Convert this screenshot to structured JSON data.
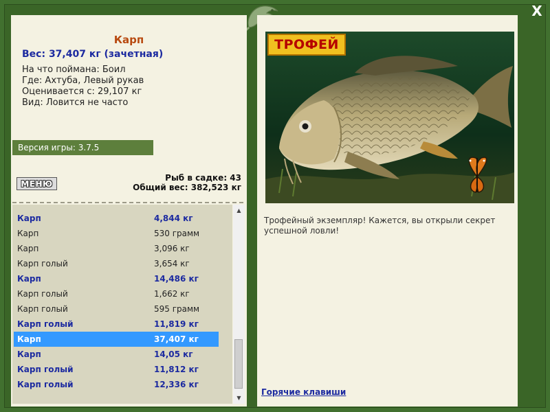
{
  "window": {
    "close_label": "X"
  },
  "fish": {
    "name": "Карп",
    "weight_line": "Вес: 37,407 кг (зачетная)",
    "caught_on": "На что поймана: Боил",
    "location": "Где: Ахтуба, Левый рукав",
    "valued_from": "Оценивается с: 29,107 кг",
    "kind": "Вид: Ловится не часто"
  },
  "version": "Версия игры: 3.7.5",
  "menu_label": "МЕНЮ",
  "stats": {
    "count_line": "Рыб в садке: 43",
    "total_line": "Общий вес: 382,523 кг"
  },
  "catch_list": [
    {
      "name": "Карп",
      "weight": "4,844 кг",
      "style": "bold"
    },
    {
      "name": "Карп",
      "weight": "530 грамм",
      "style": "normal"
    },
    {
      "name": "Карп",
      "weight": "3,096 кг",
      "style": "normal"
    },
    {
      "name": "Карп голый",
      "weight": "3,654 кг",
      "style": "normal"
    },
    {
      "name": "Карп",
      "weight": "14,486 кг",
      "style": "bold"
    },
    {
      "name": "Карп голый",
      "weight": "1,662 кг",
      "style": "normal"
    },
    {
      "name": "Карп голый",
      "weight": "595 грамм",
      "style": "normal"
    },
    {
      "name": "Карп голый",
      "weight": "11,819 кг",
      "style": "bold"
    },
    {
      "name": "Карп",
      "weight": "37,407 кг",
      "style": "selected"
    },
    {
      "name": "Карп",
      "weight": "14,05 кг",
      "style": "bold"
    },
    {
      "name": "Карп голый",
      "weight": "11,812 кг",
      "style": "bold"
    },
    {
      "name": "Карп голый",
      "weight": "12,336 кг",
      "style": "bold"
    }
  ],
  "trophy_badge": "ТРОФЕЙ",
  "description": "Трофейный экземпляр! Кажется, вы открыли секрет успешной ловли!",
  "hotkeys_label": "Горячие клавиши",
  "colors": {
    "frame": "#41702f",
    "panel": "#f4f2e2",
    "accent_blue": "#1c2aa0",
    "fish_name": "#b84a10",
    "selected": "#3399ff",
    "version_bar": "#5d7f3c"
  }
}
